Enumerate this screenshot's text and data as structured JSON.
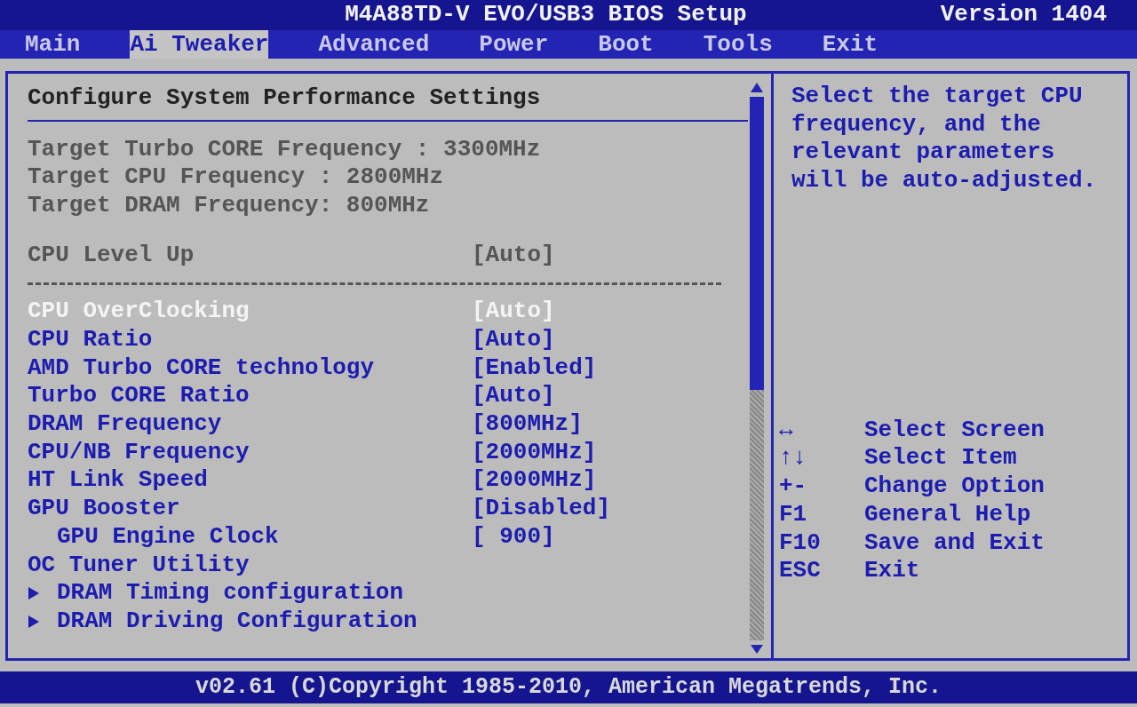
{
  "window": {
    "title": "M4A88TD-V EVO/USB3 BIOS Setup",
    "version": "Version 1404"
  },
  "tabs": [
    {
      "label": "Main",
      "selected": false
    },
    {
      "label": "Ai Tweaker",
      "selected": true
    },
    {
      "label": "Advanced",
      "selected": false
    },
    {
      "label": "Power",
      "selected": false
    },
    {
      "label": "Boot",
      "selected": false
    },
    {
      "label": "Tools",
      "selected": false
    },
    {
      "label": "Exit",
      "selected": false
    }
  ],
  "section_title": "Configure System Performance Settings",
  "info_lines": [
    "Target Turbo CORE Frequency : 3300MHz",
    "Target CPU Frequency : 2800MHz",
    "Target DRAM Frequency: 800MHz"
  ],
  "items": [
    {
      "kind": "setting",
      "label": "CPU Level Up",
      "value": "[Auto]",
      "disabled": true,
      "selected": false
    },
    {
      "kind": "separator"
    },
    {
      "kind": "setting",
      "label": "CPU OverClocking",
      "value": "[Auto]",
      "disabled": false,
      "selected": true
    },
    {
      "kind": "setting",
      "label": "CPU Ratio",
      "value": "[Auto]",
      "disabled": false,
      "selected": false
    },
    {
      "kind": "setting",
      "label": "AMD Turbo CORE technology",
      "value": "[Enabled]",
      "disabled": false,
      "selected": false
    },
    {
      "kind": "setting",
      "label": "Turbo CORE Ratio",
      "value": "[Auto]",
      "disabled": false,
      "selected": false
    },
    {
      "kind": "setting",
      "label": "DRAM Frequency",
      "value": "[800MHz]",
      "disabled": false,
      "selected": false
    },
    {
      "kind": "setting",
      "label": "CPU/NB Frequency",
      "value": "[2000MHz]",
      "disabled": false,
      "selected": false
    },
    {
      "kind": "setting",
      "label": "HT Link Speed",
      "value": "[2000MHz]",
      "disabled": false,
      "selected": false
    },
    {
      "kind": "setting",
      "label": "GPU Booster",
      "value": "[Disabled]",
      "disabled": false,
      "selected": false,
      "children": [
        {
          "kind": "setting",
          "label": "GPU Engine Clock",
          "value": "[ 900]",
          "disabled": false,
          "selected": false
        }
      ]
    },
    {
      "kind": "setting",
      "label": "OC Tuner Utility",
      "disabled": false,
      "selected": false
    },
    {
      "kind": "submenu",
      "label": "DRAM Timing configuration"
    },
    {
      "kind": "submenu",
      "label": "DRAM Driving Configuration"
    }
  ],
  "help_text": "Select the target CPU frequency, and the relevant parameters will be auto-adjusted.",
  "key_help": [
    {
      "key": "↔",
      "action": "Select Screen"
    },
    {
      "key": "↑↓",
      "action": "Select Item"
    },
    {
      "key": "+-",
      "action": "Change Option"
    },
    {
      "key": "F1",
      "action": "General Help"
    },
    {
      "key": "F10",
      "action": "Save and Exit"
    },
    {
      "key": "ESC",
      "action": "Exit"
    }
  ],
  "footer": "v02.61 (C)Copyright 1985-2010, American Megatrends, Inc."
}
